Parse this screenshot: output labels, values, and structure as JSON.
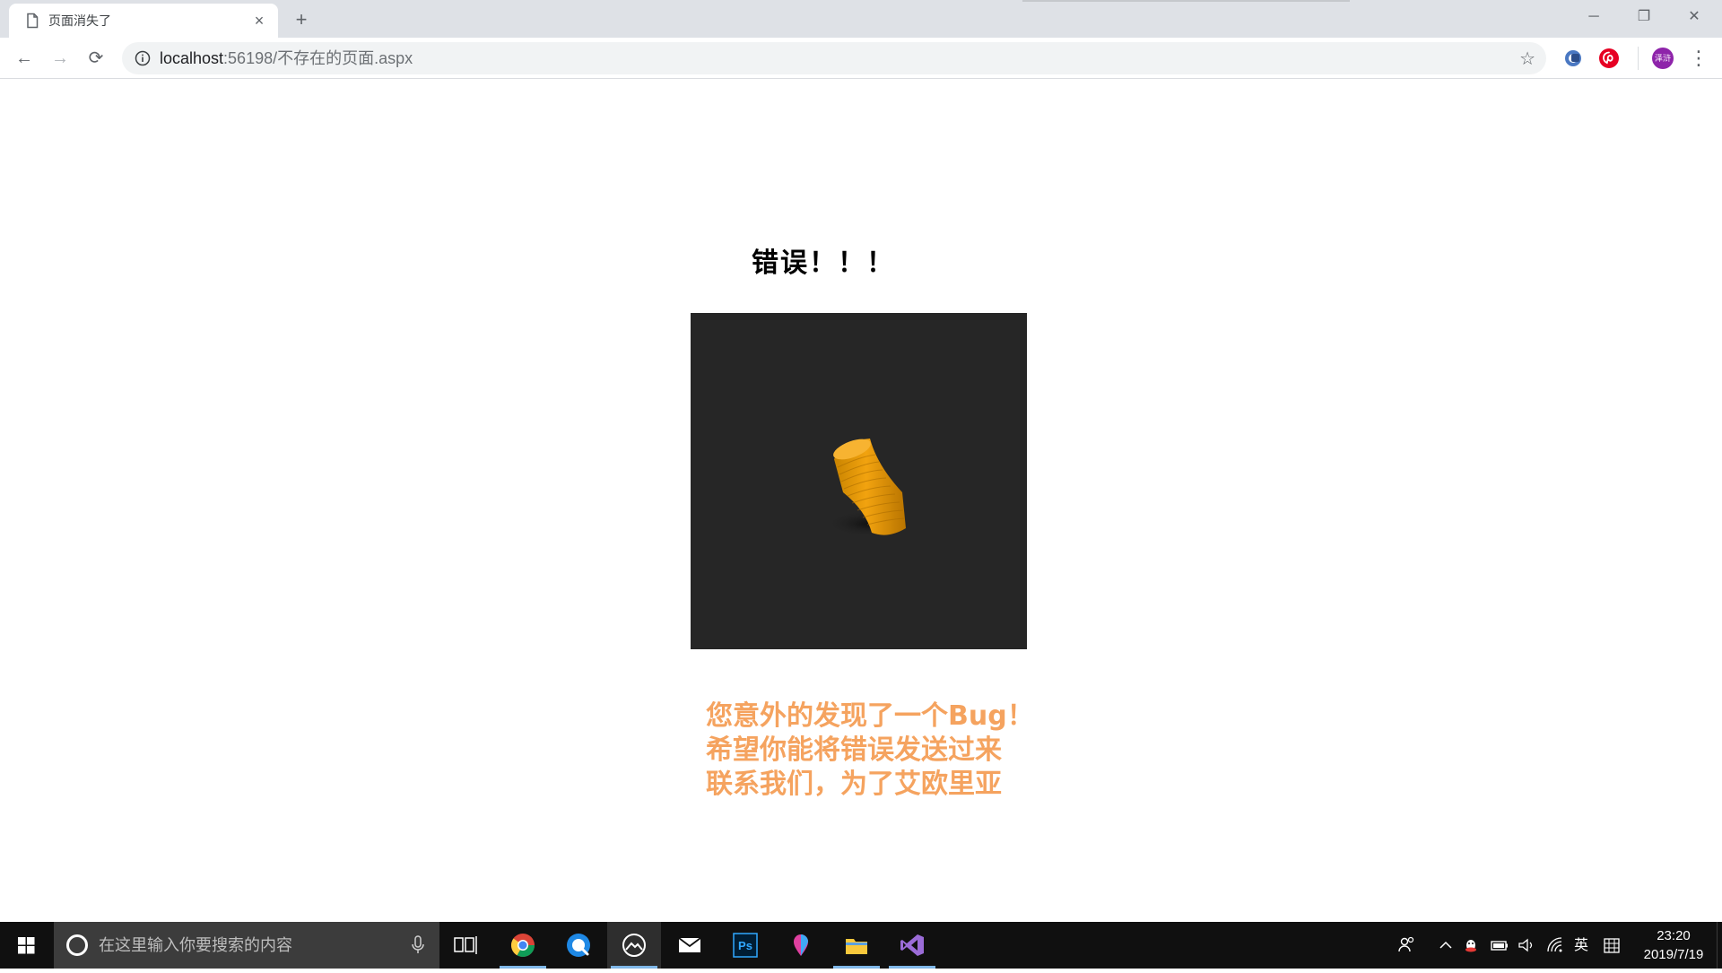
{
  "browser": {
    "tab": {
      "title": "页面消失了",
      "close_glyph": "×"
    },
    "new_tab_glyph": "+",
    "window_controls": {
      "minimize": "─",
      "restore": "❐",
      "close": "✕"
    },
    "nav": {
      "back": "←",
      "forward": "→",
      "reload": "⟳"
    },
    "address": {
      "host": "localhost",
      "rest": ":56198/不存在的页面.aspx"
    },
    "bookmark_glyph": "☆",
    "profile_initials": "泽浒",
    "menu_glyph": "⋮",
    "extension_icons": [
      "translate-extension-icon",
      "pinterest-icon"
    ]
  },
  "page": {
    "heading": "错误！！！",
    "message_lines": [
      "您意外的发现了一个Bug！",
      "希望你能将错误发送过来",
      "联系我们，为了艾欧里亚"
    ]
  },
  "taskbar": {
    "search_placeholder": "在这里输入你要搜索的内容",
    "apps": [
      "chrome-icon",
      "qq-browser-icon",
      "photos-icon",
      "mail-icon",
      "photoshop-icon",
      "maps-icon",
      "file-explorer-icon",
      "visual-studio-icon"
    ],
    "photoshop_label": "Ps",
    "ime_label": "英",
    "clock": {
      "time": "23:20",
      "date": "2019/7/19"
    }
  },
  "colors": {
    "message": "#f5a35f",
    "image_background": "#262626",
    "taskbar": "#101010"
  }
}
